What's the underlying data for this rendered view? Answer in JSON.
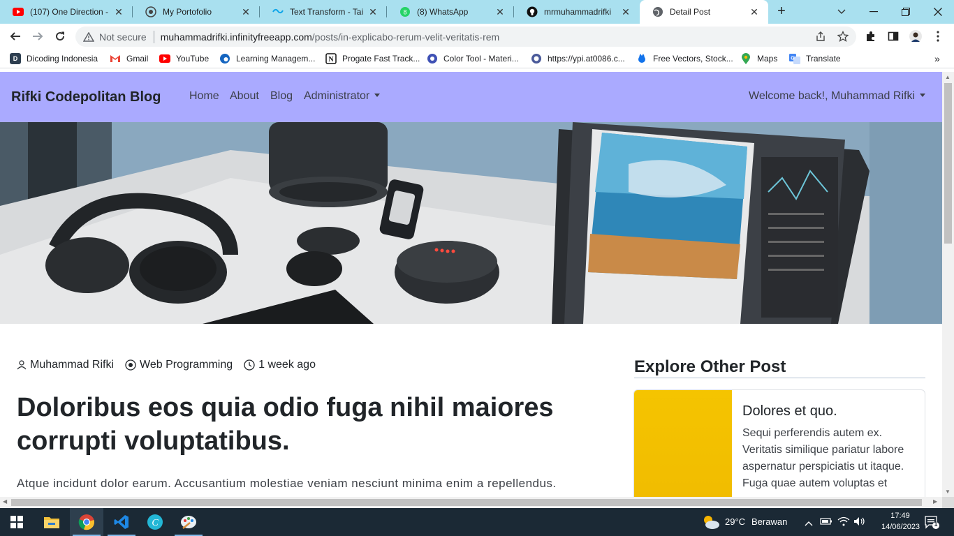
{
  "browser": {
    "tabs": [
      {
        "title": "(107) One Direction - ",
        "icon": "youtube-icon",
        "active": false
      },
      {
        "title": "My Portofolio",
        "icon": "portfolio-icon",
        "active": false
      },
      {
        "title": "Text Transform - Tailw",
        "icon": "tailwind-icon",
        "active": false
      },
      {
        "title": "(8) WhatsApp",
        "icon": "whatsapp-icon",
        "active": false
      },
      {
        "title": "mrmuhammadrifki",
        "icon": "github-icon",
        "active": false
      },
      {
        "title": "Detail Post",
        "icon": "globe-icon",
        "active": true
      }
    ],
    "address": {
      "security_label": "Not secure",
      "host": "muhammadrifki.infinityfreeapp.com",
      "path": "/posts/in-explicabo-rerum-velit-veritatis-rem"
    },
    "bookmarks": [
      {
        "label": "Dicoding Indonesia",
        "icon": "dicoding-icon"
      },
      {
        "label": "Gmail",
        "icon": "gmail-icon"
      },
      {
        "label": "YouTube",
        "icon": "youtube-icon"
      },
      {
        "label": "Learning Managem...",
        "icon": "edge-icon"
      },
      {
        "label": "Progate Fast Track...",
        "icon": "notion-icon"
      },
      {
        "label": "Color Tool - Materi...",
        "icon": "material-icon"
      },
      {
        "label": "https://ypi.at0086.c...",
        "icon": "globe-icon"
      },
      {
        "label": "Free Vectors, Stock...",
        "icon": "freepik-icon"
      },
      {
        "label": "Maps",
        "icon": "maps-icon"
      },
      {
        "label": "Translate",
        "icon": "translate-icon"
      }
    ],
    "bookmarks_overflow": "»"
  },
  "site": {
    "brand": "Rifki Codepolitan Blog",
    "nav": {
      "home": "Home",
      "about": "About",
      "blog": "Blog",
      "administrator": "Administrator",
      "welcome": "Welcome back!, Muhammad Rifki"
    }
  },
  "post": {
    "author": "Muhammad Rifki",
    "category": "Web Programming",
    "time": "1 week ago",
    "title": "Doloribus eos quia odio fuga nihil maiores corrupti voluptatibus.",
    "excerpt": "Atque incidunt dolor earum. Accusantium molestiae veniam nesciunt minima enim a repellendus."
  },
  "sidebar": {
    "heading": "Explore Other Post",
    "card": {
      "title": "Dolores et quo.",
      "text": "Sequi perferendis autem ex. Veritatis similique pariatur labore aspernatur perspiciatis ut itaque. Fuga quae autem voluptas et"
    }
  },
  "taskbar": {
    "apps": [
      "windows-start-icon",
      "file-explorer-icon",
      "chrome-icon",
      "vscode-icon",
      "canva-icon",
      "paint-icon"
    ],
    "weather": {
      "temp": "29°C",
      "condition": "Berawan"
    },
    "time": "17:49",
    "date": "14/06/2023",
    "notification_count": "1"
  },
  "colors": {
    "tabstrip": "#a9e0ef",
    "navbar": "#aaaaff",
    "card_image": "#f5c400",
    "taskbar": "#1b2935"
  }
}
